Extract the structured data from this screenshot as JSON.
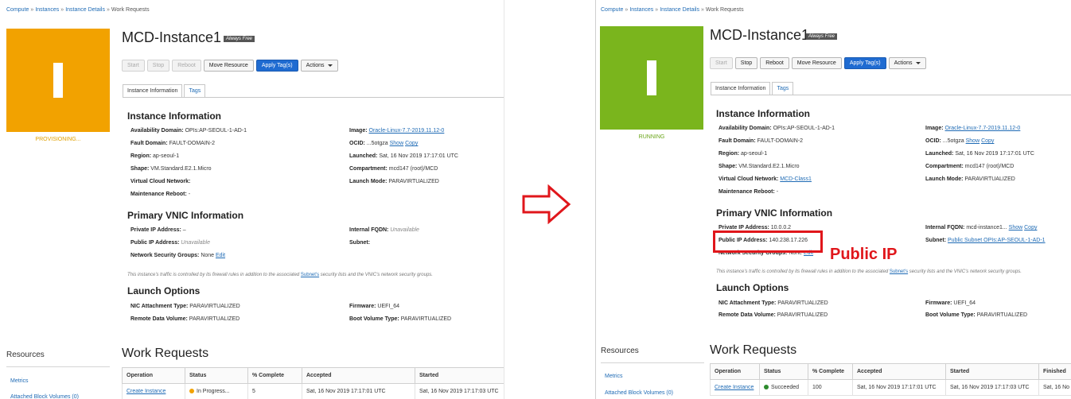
{
  "breadcrumb": [
    "Compute",
    "Instances",
    "Instance Details",
    "Work Requests"
  ],
  "instance": {
    "name": "MCD-Instance1",
    "badge": "Always Free",
    "buttons": {
      "start": "Start",
      "stop": "Stop",
      "reboot": "Reboot",
      "move": "Move Resource",
      "apply_tags": "Apply Tag(s)",
      "actions": "Actions"
    },
    "tabs": {
      "info": "Instance Information",
      "tags": "Tags"
    }
  },
  "labels": {
    "section_instance": "Instance Information",
    "availability_domain": "Availability Domain:",
    "fault_domain": "Fault Domain:",
    "region": "Region:",
    "shape": "Shape:",
    "vcn": "Virtual Cloud Network:",
    "maintenance_reboot": "Maintenance Reboot:",
    "image": "Image:",
    "ocid": "OCID:",
    "launched": "Launched:",
    "compartment": "Compartment:",
    "launch_mode": "Launch Mode:",
    "section_vnic": "Primary VNIC Information",
    "private_ip": "Private IP Address:",
    "public_ip": "Public IP Address:",
    "nsg": "Network Security Groups:",
    "internal_fqdn": "Internal FQDN:",
    "subnet": "Subnet:",
    "show": "Show",
    "copy": "Copy",
    "edit": "Edit",
    "firewall_note_pre": "This instance's traffic is controlled by its firewall rules in addition to the associated",
    "firewall_note_link": "Subnet's",
    "firewall_note_post": "security lists and the VNIC's network security groups.",
    "section_launch": "Launch Options",
    "nic_type": "NIC Attachment Type:",
    "remote_volume": "Remote Data Volume:",
    "firmware": "Firmware:",
    "boot_volume_type": "Boot Volume Type:",
    "resources": "Resources",
    "metrics": "Metrics",
    "attached_block_volumes": "Attached Block Volumes (0)",
    "work_requests": "Work Requests",
    "col_operation": "Operation",
    "col_status": "Status",
    "col_complete": "% Complete",
    "col_accepted": "Accepted",
    "col_started": "Started",
    "col_finished": "Finished"
  },
  "before": {
    "state": "PROVISIONING...",
    "state_color": "#f2a200",
    "availability_domain": "OPIs:AP-SEOUL-1-AD-1",
    "fault_domain": "FAULT-DOMAIN-2",
    "region": "ap-seoul-1",
    "shape": "VM.Standard.E2.1.Micro",
    "vcn": "",
    "maintenance_reboot": "-",
    "image": "Oracle-Linux-7.7-2019.11.12-0",
    "ocid": "...5otgza",
    "launched": "Sat, 16 Nov 2019 17:17:01 UTC",
    "compartment": "mcd147 (root)/MCD",
    "launch_mode": "PARAVIRTUALIZED",
    "private_ip": "–",
    "public_ip": "Unavailable",
    "nsg": "None",
    "internal_fqdn": "Unavailable",
    "subnet": "",
    "nic_type": "PARAVIRTUALIZED",
    "remote_volume": "PARAVIRTUALIZED",
    "firmware": "UEFI_64",
    "boot_volume_type": "PARAVIRTUALIZED",
    "wr_row": {
      "operation": "Create Instance",
      "status": "In Progress...",
      "status_color": "#f2a200",
      "complete": "5",
      "accepted": "Sat, 16 Nov 2019 17:17:01 UTC",
      "started": "Sat, 16 Nov 2019 17:17:03 UTC"
    }
  },
  "after": {
    "state": "RUNNING",
    "state_color": "#7ab51d",
    "availability_domain": "OPIs:AP-SEOUL-1-AD-1",
    "fault_domain": "FAULT-DOMAIN-2",
    "region": "ap-seoul-1",
    "shape": "VM.Standard.E2.1.Micro",
    "vcn": "MCD-Class1",
    "maintenance_reboot": "-",
    "image": "Oracle-Linux-7.7-2019.11.12-0",
    "ocid": "...5otgza",
    "launched": "Sat, 16 Nov 2019 17:17:01 UTC",
    "compartment": "mcd147 (root)/MCD",
    "launch_mode": "PARAVIRTUALIZED",
    "private_ip": "10.0.0.2",
    "public_ip": "140.238.17.226",
    "nsg": "None",
    "internal_fqdn": "mcd-instance1...",
    "subnet": "Public Subnet OPIs:AP-SEOUL-1-AD-1",
    "nic_type": "PARAVIRTUALIZED",
    "remote_volume": "PARAVIRTUALIZED",
    "firmware": "UEFI_64",
    "boot_volume_type": "PARAVIRTUALIZED",
    "wr_row": {
      "operation": "Create Instance",
      "status": "Succeeded",
      "status_color": "#2e8b2e",
      "complete": "100",
      "accepted": "Sat, 16 Nov 2019 17:17:01 UTC",
      "started": "Sat, 16 Nov 2019 17:17:03 UTC",
      "finished": "Sat, 16 No"
    }
  },
  "annotation": {
    "callout": "Public IP",
    "color": "#e0161b"
  }
}
